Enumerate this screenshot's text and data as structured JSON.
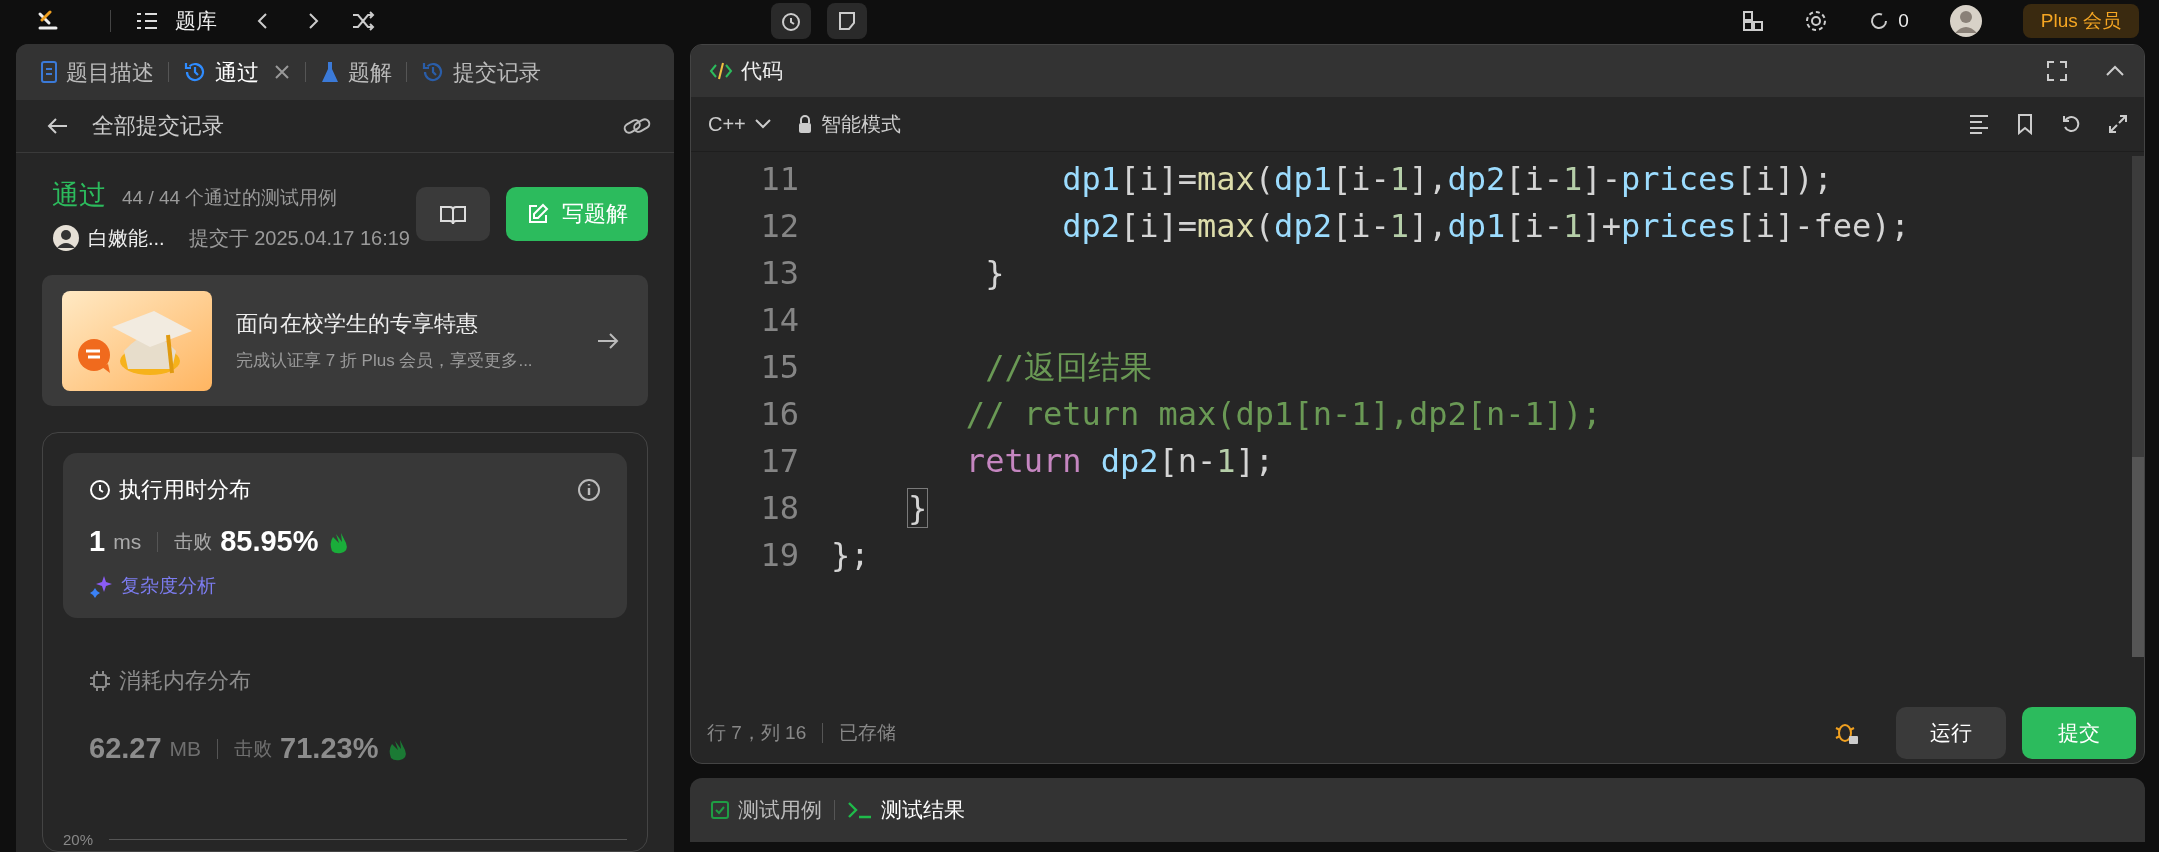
{
  "top_bar": {
    "problem_bank": "题库",
    "counter": "0",
    "plus_button": "Plus 会员"
  },
  "left_panel": {
    "tabs": [
      {
        "label": "题目描述",
        "selected": false,
        "closable": false,
        "kind": "doc"
      },
      {
        "label": "通过",
        "selected": true,
        "closable": true,
        "kind": "history"
      },
      {
        "label": "题解",
        "selected": false,
        "closable": false,
        "kind": "flask"
      },
      {
        "label": "提交记录",
        "selected": false,
        "closable": false,
        "kind": "history"
      }
    ],
    "back_title": "全部提交记录",
    "result": {
      "status": "通过",
      "cases": "44 / 44 个通过的测试用例",
      "user": "白嫩能...",
      "submitted": "提交于 2025.04.17 16:19",
      "write_button": "写题解"
    },
    "promo": {
      "title": "面向在校学生的专享特惠",
      "subtitle": "完成认证享 7 折 Plus 会员，享受更多..."
    },
    "stats": [
      {
        "kind": "clock",
        "title": "执行用时分布",
        "value": "1",
        "unit": "ms",
        "beat_label": "击败",
        "beat": "85.95%",
        "link": "复杂度分析",
        "selected": true
      },
      {
        "kind": "chip",
        "title": "消耗内存分布",
        "value": "62.27",
        "unit": "MB",
        "beat_label": "击败",
        "beat": "71.23%",
        "selected": false
      }
    ],
    "chart_tick": "20%"
  },
  "editor": {
    "title": "代码",
    "language": "C++",
    "mode": "智能模式",
    "lines": [
      {
        "number": "11",
        "tokens": [
          {
            "text": "            dp1",
            "kind": "var"
          },
          {
            "text": "[i]=",
            "kind": "plain"
          },
          {
            "text": "max",
            "kind": "fn"
          },
          {
            "text": "(",
            "kind": "plain"
          },
          {
            "text": "dp1",
            "kind": "var"
          },
          {
            "text": "[i-",
            "kind": "plain"
          },
          {
            "text": "1",
            "kind": "num"
          },
          {
            "text": "],",
            "kind": "plain"
          },
          {
            "text": "dp2",
            "kind": "var"
          },
          {
            "text": "[i-",
            "kind": "plain"
          },
          {
            "text": "1",
            "kind": "num"
          },
          {
            "text": "]-",
            "kind": "plain"
          },
          {
            "text": "prices",
            "kind": "var"
          },
          {
            "text": "[i]);",
            "kind": "plain"
          }
        ]
      },
      {
        "number": "12",
        "tokens": [
          {
            "text": "            dp2",
            "kind": "var"
          },
          {
            "text": "[i]=",
            "kind": "plain"
          },
          {
            "text": "max",
            "kind": "fn"
          },
          {
            "text": "(",
            "kind": "plain"
          },
          {
            "text": "dp2",
            "kind": "var"
          },
          {
            "text": "[i-",
            "kind": "plain"
          },
          {
            "text": "1",
            "kind": "num"
          },
          {
            "text": "],",
            "kind": "plain"
          },
          {
            "text": "dp1",
            "kind": "var"
          },
          {
            "text": "[i-",
            "kind": "plain"
          },
          {
            "text": "1",
            "kind": "num"
          },
          {
            "text": "]+",
            "kind": "plain"
          },
          {
            "text": "prices",
            "kind": "var"
          },
          {
            "text": "[i]-fee);",
            "kind": "plain"
          }
        ]
      },
      {
        "number": "13",
        "tokens": [
          {
            "text": "        }",
            "kind": "plain"
          }
        ]
      },
      {
        "number": "14"
      },
      {
        "number": "15",
        "tokens": [
          {
            "text": "        //返回结果",
            "kind": "comment"
          }
        ]
      },
      {
        "number": "16",
        "tokens": [
          {
            "text": "       // return max(dp1[n-1],dp2[n-1]);",
            "kind": "comment"
          }
        ]
      },
      {
        "number": "17",
        "tokens": [
          {
            "text": "       return",
            "kind": "keyword"
          },
          {
            "text": " dp2",
            "kind": "var"
          },
          {
            "text": "[n-",
            "kind": "plain"
          },
          {
            "text": "1",
            "kind": "num"
          },
          {
            "text": "];",
            "kind": "plain"
          }
        ]
      },
      {
        "number": "18",
        "tokens": [
          {
            "text": "    }",
            "kind": "match"
          }
        ]
      },
      {
        "number": "19",
        "tokens": [
          {
            "text": "};",
            "kind": "plain"
          }
        ]
      }
    ],
    "position": "行 7，列 16",
    "saved": "已存储",
    "run_button": "运行",
    "submit_button": "提交"
  },
  "bottom_tabs": [
    {
      "label": "测试用例",
      "selected": false,
      "kind": "check"
    },
    {
      "label": "测试结果",
      "selected": true,
      "kind": "terminal"
    }
  ]
}
